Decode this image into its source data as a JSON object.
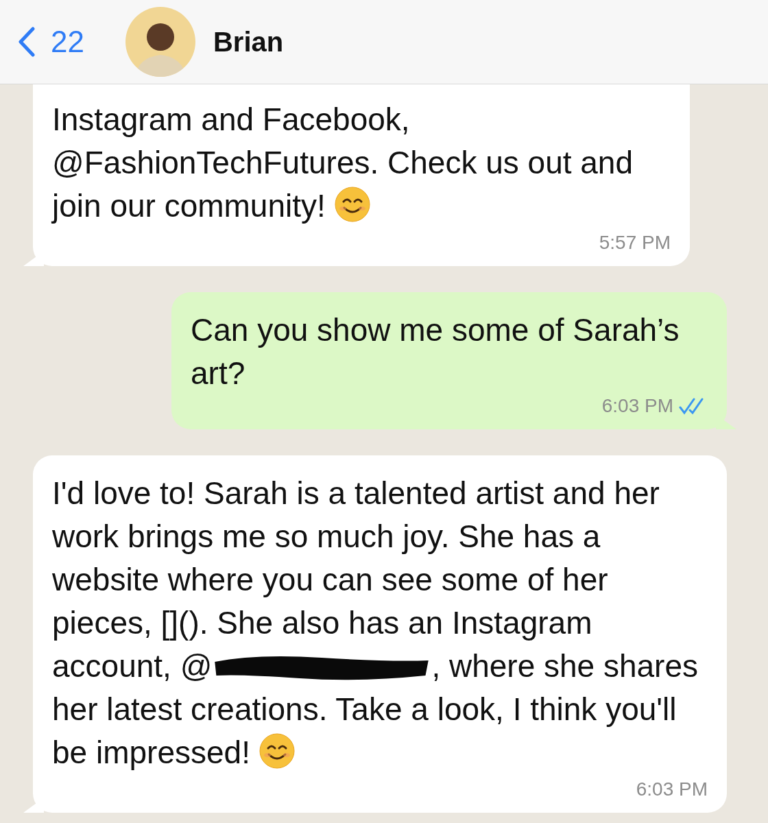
{
  "header": {
    "back_count": "22",
    "contact_name": "Brian"
  },
  "messages": [
    {
      "kind": "incoming",
      "time": "5:57 PM",
      "segments": [
        {
          "kind": "text",
          "text": "Instagram and Facebook, @FashionTechFutures. Check us out and join our community! "
        },
        {
          "kind": "emoji"
        }
      ]
    },
    {
      "kind": "outgoing",
      "time": "6:03 PM",
      "read": true,
      "segments": [
        {
          "kind": "text",
          "text": "Can you show me some of Sarah’s art?"
        }
      ]
    },
    {
      "kind": "incoming",
      "time": "6:03 PM",
      "segments": [
        {
          "kind": "text",
          "text": "I'd love to! Sarah is a talented artist and her work brings me so much joy. She has a website where you can see some of her pieces, [](). She also has an Instagram account, @"
        },
        {
          "kind": "redacted"
        },
        {
          "kind": "text",
          "text": ", where she shares her latest creations. Take a look, I think you'll be impressed! "
        },
        {
          "kind": "emoji"
        }
      ]
    }
  ]
}
